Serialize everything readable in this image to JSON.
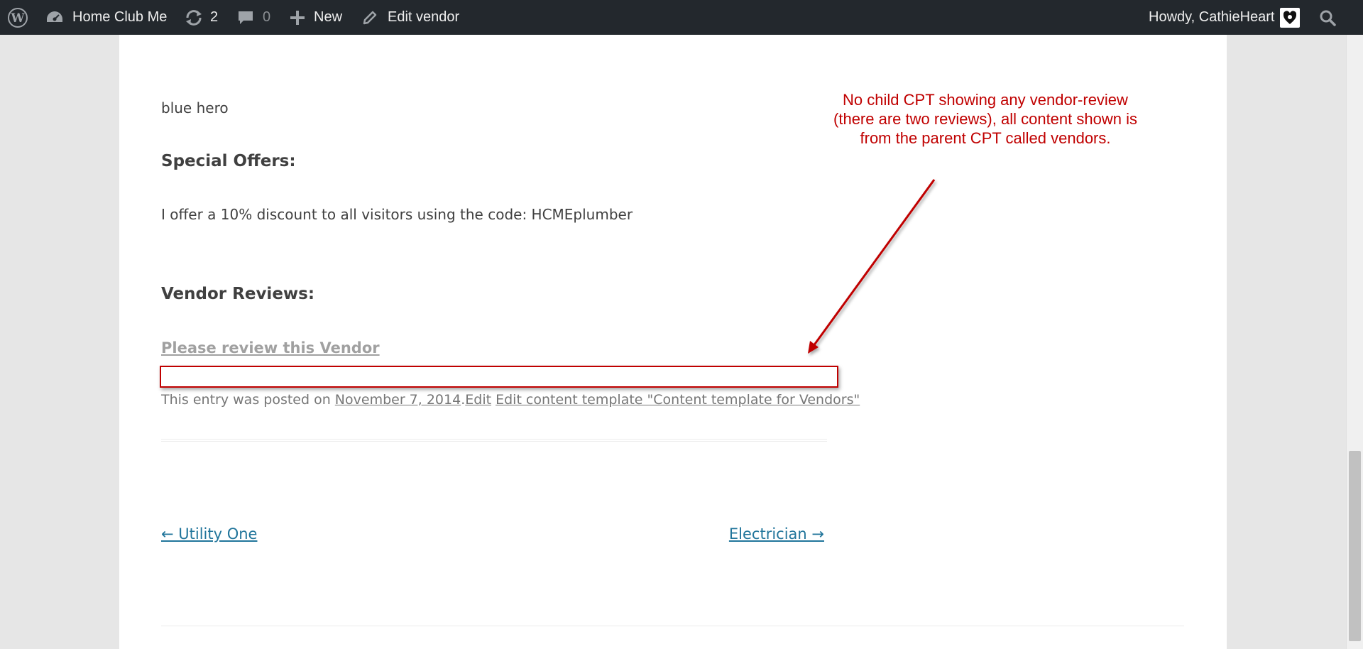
{
  "admin_bar": {
    "site_name": "Home Club Me",
    "updates_count": "2",
    "comments_count": "0",
    "new_label": "New",
    "edit_label": "Edit vendor",
    "greeting": "Howdy, CathieHeart",
    "bg_color": "#23282d"
  },
  "post": {
    "tagline": "blue hero",
    "special_offers_heading": "Special Offers:",
    "special_offers_text": "I offer a 10% discount to all visitors using the code: HCMEplumber",
    "vendor_reviews_heading": "Vendor Reviews:",
    "review_link": "Please review this Vendor",
    "meta_prefix": "This entry was posted on ",
    "meta_date": "November 7, 2014",
    "meta_dot": ".",
    "meta_edit": "Edit",
    "meta_template_link": "Edit content template \"Content template for Vendors\""
  },
  "post_nav": {
    "previous": "← Utility One",
    "next": "Electrician →",
    "link_color": "#21759b"
  },
  "annotation": {
    "line1": "No child CPT showing any vendor-review",
    "line2": "(there are two reviews), all content shown is",
    "line3": "from the parent CPT called vendors.",
    "color": "#c00000"
  },
  "icons": {
    "wp_logo": "wordpress-logo-icon",
    "dashboard": "dashboard-icon",
    "updates": "updates-icon",
    "comments": "comments-icon",
    "new": "plus-icon",
    "edit": "pencil-icon",
    "search": "search-icon",
    "avatar": "avatar-icon"
  }
}
